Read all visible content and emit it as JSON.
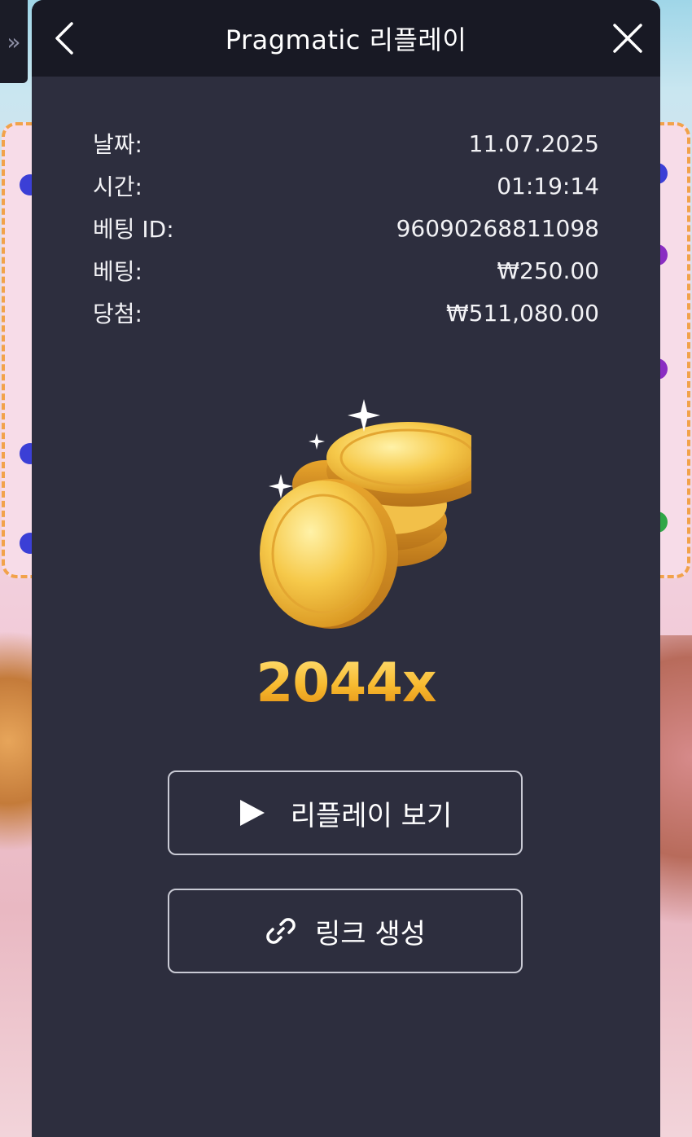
{
  "header": {
    "title": "Pragmatic 리플레이",
    "back_icon": "chevron-left-icon",
    "close_icon": "close-icon"
  },
  "side_tab": {
    "icon": "double-chevron-right-icon",
    "glyph": "»"
  },
  "bet_info": [
    {
      "label": "날짜:",
      "value": "11.07.2025"
    },
    {
      "label": "시간:",
      "value": "01:19:14"
    },
    {
      "label": "베팅 ID:",
      "value": "96090268811098"
    },
    {
      "label": "베팅:",
      "value": "₩250.00"
    },
    {
      "label": "당첨:",
      "value": "₩511,080.00"
    }
  ],
  "result": {
    "image": "gold-coins-icon",
    "multiplier": "2044x"
  },
  "actions": {
    "replay": {
      "label": "리플레이 보기",
      "icon": "play-icon"
    },
    "link": {
      "label": "링크 생성",
      "icon": "link-icon"
    }
  },
  "colors": {
    "modal_bg": "#2d2e3e",
    "header_bg": "#181924",
    "gold": "#f7b92e"
  }
}
